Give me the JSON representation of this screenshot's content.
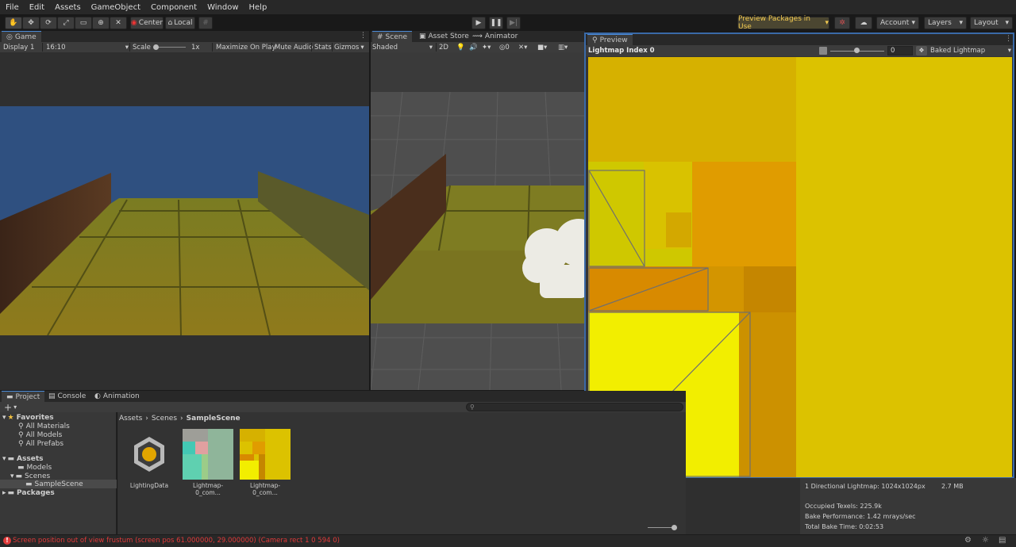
{
  "menu": [
    "File",
    "Edit",
    "Assets",
    "GameObject",
    "Component",
    "Window",
    "Help"
  ],
  "toolbar": {
    "center_label": "Center",
    "local_label": "Local",
    "packages_label": "Preview Packages in Use",
    "account_label": "Account",
    "layers_label": "Layers",
    "layout_label": "Layout"
  },
  "game": {
    "tab_label": "Game",
    "display": "Display 1",
    "aspect": "16:10",
    "scale_label": "Scale",
    "scale_value": "1x",
    "maximize": "Maximize On Play",
    "mute": "Mute Audio",
    "stats": "Stats",
    "gizmos": "Gizmos"
  },
  "scene": {
    "tabs": [
      "Scene",
      "Asset Store",
      "Animator"
    ],
    "shading": "Shaded",
    "mode_2d": "2D",
    "fx_count": "0"
  },
  "preview": {
    "tab_label": "Preview",
    "title": "Lightmap Index 0",
    "exposure": "0",
    "mode": "Baked Lightmap"
  },
  "project": {
    "tabs": [
      "Project",
      "Console",
      "Animation"
    ],
    "add": "+",
    "breadcrumb": [
      "Assets",
      "Scenes",
      "SampleScene"
    ],
    "tree": {
      "favorites": "Favorites",
      "fav_items": [
        "All Materials",
        "All Models",
        "All Prefabs"
      ],
      "assets": "Assets",
      "models": "Models",
      "scenes": "Scenes",
      "sample_scene": "SampleScene",
      "packages": "Packages"
    },
    "assets": [
      "LightingData",
      "Lightmap-0_com...",
      "Lightmap-0_com..."
    ]
  },
  "lighting": {
    "lightmap_info": "1 Directional Lightmap: 1024x1024px",
    "size": "2.7 MB",
    "occupied": "Occupied Texels: 225.9k",
    "performance": "Bake Performance: 1.42 mrays/sec",
    "bake_time": "Total Bake Time: 0:02:53"
  },
  "status": {
    "message": "Screen position out of view frustum (screen pos 61.000000, 29.000000) (Camera rect 1 0 594 0)",
    "error_color": "#e03a3a"
  }
}
